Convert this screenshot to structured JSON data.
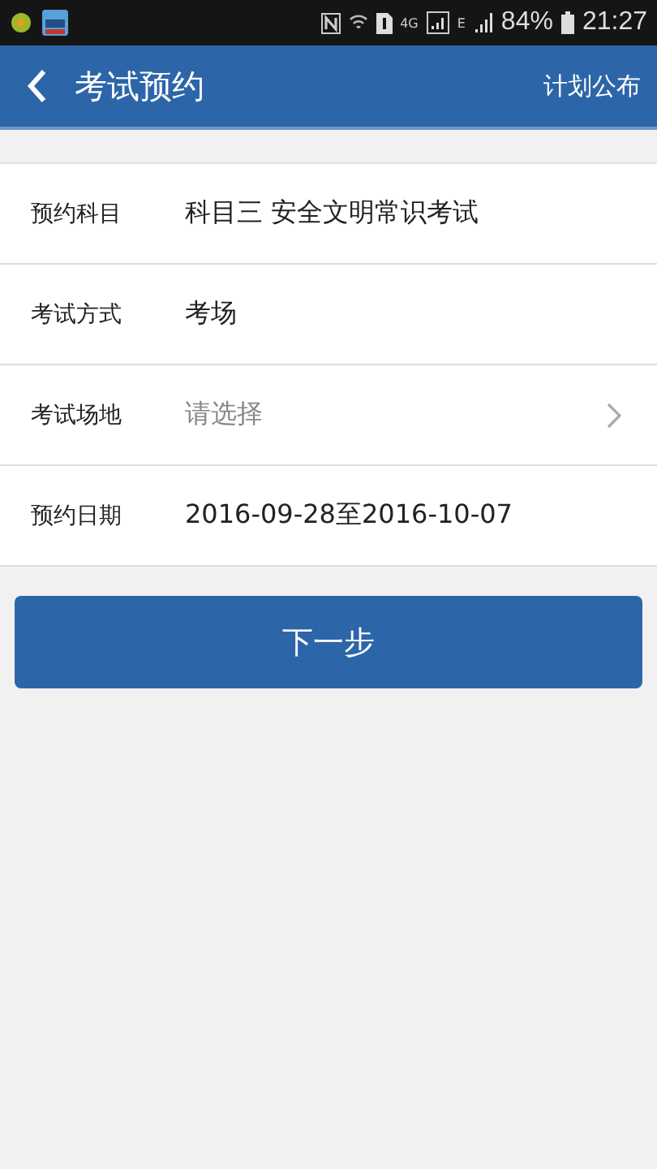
{
  "status_bar": {
    "network_4g": "4G",
    "network_e": "E",
    "battery": "84%",
    "time": "21:27"
  },
  "header": {
    "title": "考试预约",
    "action": "计划公布"
  },
  "rows": [
    {
      "kind": "value",
      "label": "预约科目",
      "value": "科目三 安全文明常识考试"
    },
    {
      "kind": "value",
      "label": "考试方式",
      "value": "考场"
    },
    {
      "kind": "select",
      "label": "考试场地",
      "placeholder": "请选择"
    },
    {
      "kind": "value",
      "label": "预约日期",
      "value": "2016-09-28至2016-10-07"
    }
  ],
  "next_button": "下一步"
}
